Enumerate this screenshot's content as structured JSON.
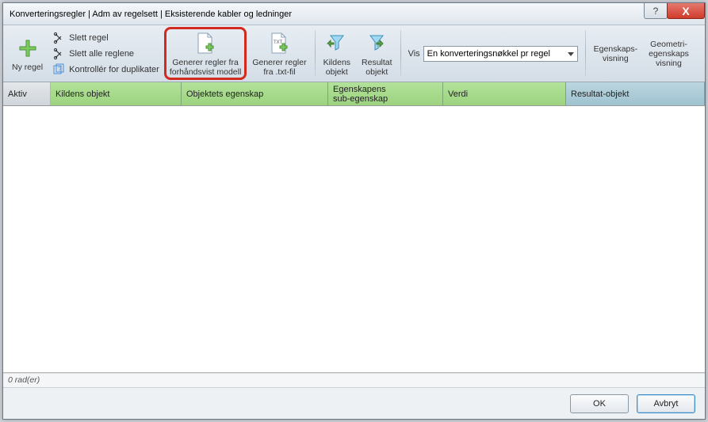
{
  "titlebar": {
    "title": "Konverteringsregler | Adm av regelsett | Eksisterende kabler og ledninger",
    "help_symbol": "?",
    "close_symbol": "X"
  },
  "ribbon": {
    "ny_regel": "Ny regel",
    "slett_regel": "Slett regel",
    "slett_alle": "Slett alle reglene",
    "kontroller_dup": "Kontrollér for duplikater",
    "gen_fra_modell_l1": "Generer regler fra",
    "gen_fra_modell_l2": "forhåndsvist modell",
    "gen_fra_txt_l1": "Generer regler",
    "gen_fra_txt_l2": "fra .txt-fil",
    "kildens_objekt_l1": "Kildens",
    "kildens_objekt_l2": "objekt",
    "resultat_objekt_l1": "Resultat",
    "resultat_objekt_l2": "objekt",
    "vis_label": "Vis",
    "vis_selected": "En konverteringsnøkkel pr regel",
    "egenskaps_l1": "Egenskaps-",
    "egenskaps_l2": "visning",
    "geom_l1": "Geometri-",
    "geom_l2": "egenskaps",
    "geom_l3": "visning"
  },
  "columns": {
    "aktiv": "Aktiv",
    "kildens_objekt": "Kildens objekt",
    "objektets_egenskap": "Objektets egenskap",
    "egenskapens_sub_l1": "Egenskapens",
    "egenskapens_sub_l2": "sub-egenskap",
    "verdi": "Verdi",
    "resultat_objekt": "Resultat-objekt"
  },
  "status": {
    "rows": "0 rad(er)"
  },
  "footer": {
    "ok": "OK",
    "cancel": "Avbryt"
  }
}
